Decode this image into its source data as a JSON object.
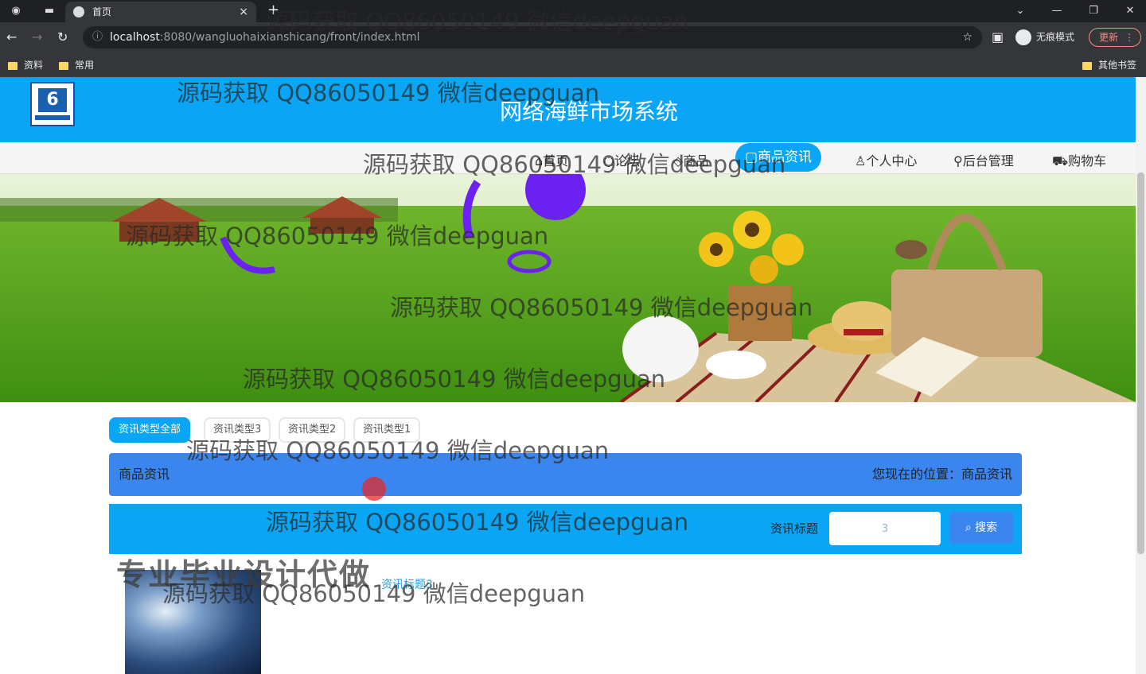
{
  "browser": {
    "tab_title": "首页",
    "tab_close": "×",
    "new_tab": "+",
    "url_host": "localhost",
    "url_rest": ":8080/wangluohaixianshicang/front/index.html",
    "profile_label": "无痕模式",
    "update_label": "更新",
    "bookmarks": [
      "资料",
      "常用"
    ],
    "other_bookmarks": "其他书签",
    "window_controls": [
      "⌄",
      "—",
      "❐",
      "✕"
    ]
  },
  "site": {
    "title": "网络海鲜市场系统",
    "logo_text": "6",
    "nav": [
      {
        "label": "首页",
        "icon": "home-icon"
      },
      {
        "label": "论坛",
        "icon": "forum-icon"
      },
      {
        "label": "商品",
        "icon": "goods-icon"
      },
      {
        "label": "商品资讯",
        "icon": "news-icon"
      },
      {
        "label": "个人中心",
        "icon": "user-icon"
      },
      {
        "label": "后台管理",
        "icon": "link-icon"
      },
      {
        "label": "购物车",
        "icon": "cart-icon"
      }
    ],
    "categories": [
      "资讯类型全部",
      "资讯类型3",
      "资讯类型2",
      "资讯类型1"
    ],
    "crumb_left": "商品资讯",
    "crumb_right": "您现在的位置：商品资讯",
    "search_label": "资讯标题",
    "search_value": "3",
    "search_button": "搜索",
    "news_title": "资讯标题3"
  },
  "watermarks": [
    "源码获取 QQ86050149 微信deepguan",
    "专业毕业设计代做"
  ],
  "colors": {
    "header_blue": "#0aa6f5",
    "crumb_blue": "#3a86ee"
  }
}
